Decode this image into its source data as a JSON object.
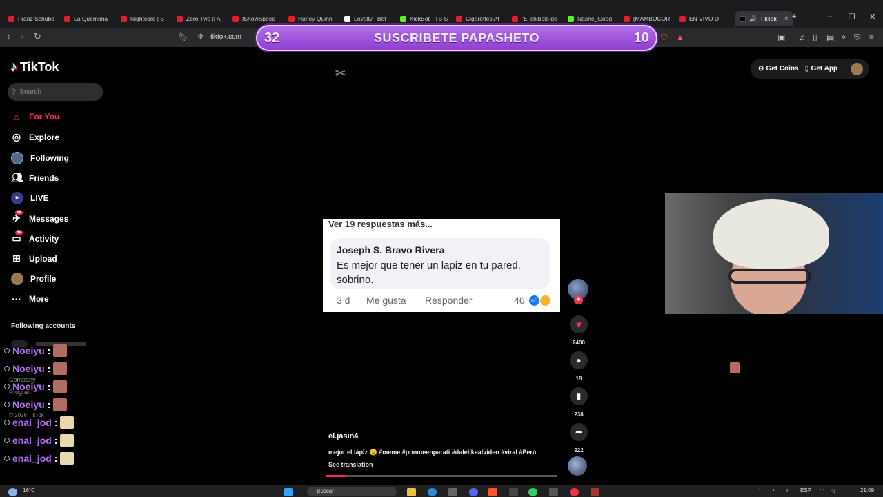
{
  "browser": {
    "tabs": [
      {
        "label": "Franz Schube",
        "color": "#e31e2b"
      },
      {
        "label": "La Quemona",
        "color": "#e31e2b"
      },
      {
        "label": "Nightcore | S",
        "color": "#e31e2b"
      },
      {
        "label": "Zero Two || A",
        "color": "#e31e2b"
      },
      {
        "label": "IShowSpeed",
        "color": "#e31e2b"
      },
      {
        "label": "Harley Quinn",
        "color": "#e31e2b"
      },
      {
        "label": "Loyalty | Bot",
        "color": "#ffffff"
      },
      {
        "label": "KickBot TTS S",
        "color": "#53fc18"
      },
      {
        "label": "Cigarettes Af",
        "color": "#e31e2b"
      },
      {
        "label": "\"El chibolo de",
        "color": "#e31e2b"
      },
      {
        "label": "Nashe_Good",
        "color": "#53fc18"
      },
      {
        "label": "[MAMBOCOR",
        "color": "#e31e2b"
      },
      {
        "label": "EN VIVO D",
        "color": "#e31e2b"
      }
    ],
    "active_tab": "TikTok",
    "url": "tiktok.com"
  },
  "banner": {
    "left_num": "32",
    "text": "SUSCRIBETE PAPASHETO",
    "right_num": "10"
  },
  "tiktok": {
    "brand": "TikTok",
    "search_placeholder": "Search",
    "nav": {
      "for_you": "For You",
      "explore": "Explore",
      "following": "Following",
      "friends": "Friends",
      "live": "LIVE",
      "messages": "Messages",
      "messages_badge": "69",
      "activity": "Activity",
      "activity_badge": "59",
      "upload": "Upload",
      "profile": "Profile",
      "more": "More"
    },
    "following_accounts": "Following accounts",
    "footer": {
      "company": "Company",
      "program": "Program",
      "copyright": "© 2026 TikTok"
    },
    "get_coins": "Get Coins",
    "get_app": "Get App"
  },
  "chat": [
    {
      "name": "Noeiyu",
      "color": "#b46cf0"
    },
    {
      "name": "Noeiyu",
      "color": "#b46cf0"
    },
    {
      "name": "Noeiyu",
      "color": "#b46cf0"
    },
    {
      "name": "Noeiyu",
      "color": "#b46cf0"
    },
    {
      "name": "enai_jod",
      "color": "#b46cf0"
    },
    {
      "name": "enai_jod",
      "color": "#b46cf0"
    },
    {
      "name": "enai_jod",
      "color": "#b46cf0"
    }
  ],
  "chat_separator": ":",
  "comment": {
    "more": "Ver 19 respuestas más...",
    "author": "Joseph S. Bravo Rivera",
    "text": "Es mejor que tener un lapiz en tu pared, sobrino.",
    "age": "3 d",
    "like": "Me gusta",
    "reply": "Responder",
    "reactions": "46"
  },
  "actions": {
    "likes": "2400",
    "comments": "18",
    "saves": "238",
    "shares": "922"
  },
  "post": {
    "author": "el.jasin4",
    "caption": "mejor el lápiz 😮 #meme #ponmeenparati #dalelikealvideo #viral #Perú",
    "see_translation": "See translation",
    "progress": 0.08
  },
  "taskbar": {
    "weather": "16°C",
    "search": "Buscar",
    "lang": "ESP",
    "time": "21:09"
  }
}
